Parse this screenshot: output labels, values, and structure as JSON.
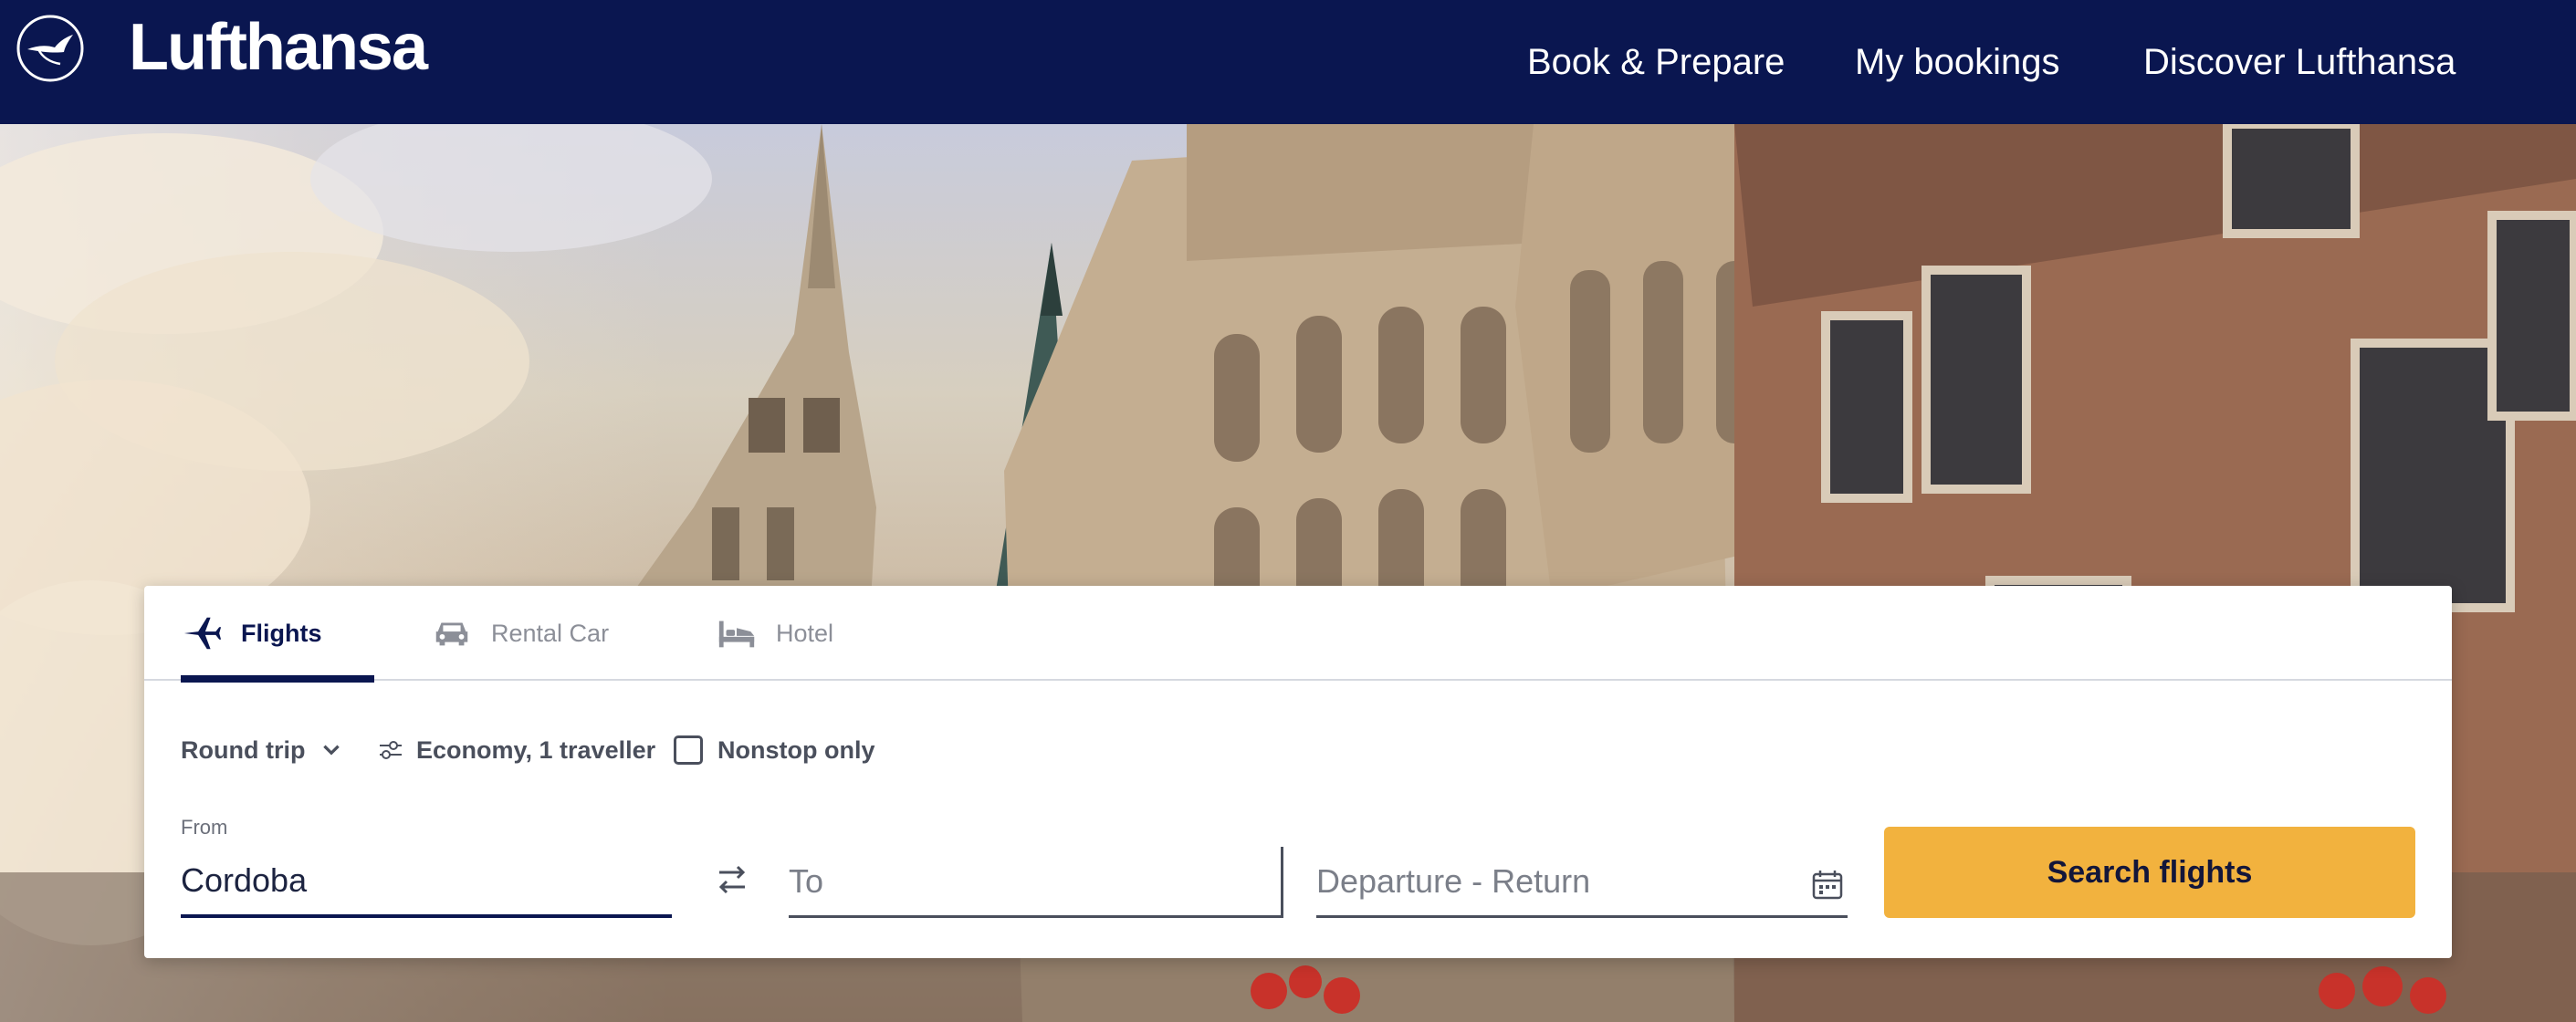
{
  "header": {
    "brand": "Lufthansa",
    "logo_icon": "lufthansa-crane-icon",
    "nav": [
      {
        "label": "Book & Prepare"
      },
      {
        "label": "My bookings"
      },
      {
        "label": "Discover Lufthansa"
      }
    ]
  },
  "hero": {
    "image": "munich-new-town-hall-facade"
  },
  "booking": {
    "tabs": [
      {
        "label": "Flights",
        "icon": "airplane-icon",
        "active": true
      },
      {
        "label": "Rental Car",
        "icon": "car-icon",
        "active": false
      },
      {
        "label": "Hotel",
        "icon": "bed-icon",
        "active": false
      }
    ],
    "trip_type": "Round trip",
    "cabin": "Economy, 1 traveller",
    "nonstop_label": "Nonstop only",
    "nonstop_checked": false,
    "from_label": "From",
    "from_value": "Cordoba",
    "to_placeholder": "To",
    "dates_placeholder": "Departure - Return",
    "search_label": "Search flights"
  },
  "colors": {
    "navy": "#0a1650",
    "search_button": "#f2b23e",
    "text_muted": "#8c8f98"
  }
}
